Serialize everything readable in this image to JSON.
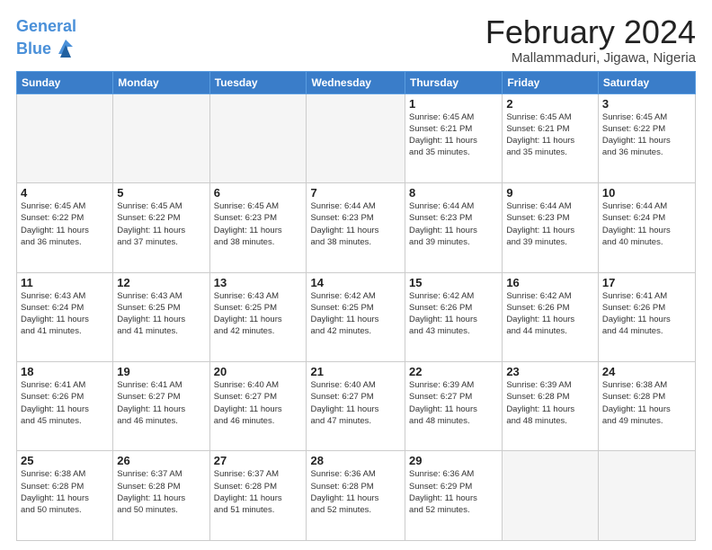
{
  "header": {
    "logo_line1": "General",
    "logo_line2": "Blue",
    "title": "February 2024",
    "subtitle": "Mallammaduri, Jigawa, Nigeria"
  },
  "days_of_week": [
    "Sunday",
    "Monday",
    "Tuesday",
    "Wednesday",
    "Thursday",
    "Friday",
    "Saturday"
  ],
  "weeks": [
    [
      {
        "day": "",
        "info": ""
      },
      {
        "day": "",
        "info": ""
      },
      {
        "day": "",
        "info": ""
      },
      {
        "day": "",
        "info": ""
      },
      {
        "day": "1",
        "info": "Sunrise: 6:45 AM\nSunset: 6:21 PM\nDaylight: 11 hours\nand 35 minutes."
      },
      {
        "day": "2",
        "info": "Sunrise: 6:45 AM\nSunset: 6:21 PM\nDaylight: 11 hours\nand 35 minutes."
      },
      {
        "day": "3",
        "info": "Sunrise: 6:45 AM\nSunset: 6:22 PM\nDaylight: 11 hours\nand 36 minutes."
      }
    ],
    [
      {
        "day": "4",
        "info": "Sunrise: 6:45 AM\nSunset: 6:22 PM\nDaylight: 11 hours\nand 36 minutes."
      },
      {
        "day": "5",
        "info": "Sunrise: 6:45 AM\nSunset: 6:22 PM\nDaylight: 11 hours\nand 37 minutes."
      },
      {
        "day": "6",
        "info": "Sunrise: 6:45 AM\nSunset: 6:23 PM\nDaylight: 11 hours\nand 38 minutes."
      },
      {
        "day": "7",
        "info": "Sunrise: 6:44 AM\nSunset: 6:23 PM\nDaylight: 11 hours\nand 38 minutes."
      },
      {
        "day": "8",
        "info": "Sunrise: 6:44 AM\nSunset: 6:23 PM\nDaylight: 11 hours\nand 39 minutes."
      },
      {
        "day": "9",
        "info": "Sunrise: 6:44 AM\nSunset: 6:23 PM\nDaylight: 11 hours\nand 39 minutes."
      },
      {
        "day": "10",
        "info": "Sunrise: 6:44 AM\nSunset: 6:24 PM\nDaylight: 11 hours\nand 40 minutes."
      }
    ],
    [
      {
        "day": "11",
        "info": "Sunrise: 6:43 AM\nSunset: 6:24 PM\nDaylight: 11 hours\nand 41 minutes."
      },
      {
        "day": "12",
        "info": "Sunrise: 6:43 AM\nSunset: 6:25 PM\nDaylight: 11 hours\nand 41 minutes."
      },
      {
        "day": "13",
        "info": "Sunrise: 6:43 AM\nSunset: 6:25 PM\nDaylight: 11 hours\nand 42 minutes."
      },
      {
        "day": "14",
        "info": "Sunrise: 6:42 AM\nSunset: 6:25 PM\nDaylight: 11 hours\nand 42 minutes."
      },
      {
        "day": "15",
        "info": "Sunrise: 6:42 AM\nSunset: 6:26 PM\nDaylight: 11 hours\nand 43 minutes."
      },
      {
        "day": "16",
        "info": "Sunrise: 6:42 AM\nSunset: 6:26 PM\nDaylight: 11 hours\nand 44 minutes."
      },
      {
        "day": "17",
        "info": "Sunrise: 6:41 AM\nSunset: 6:26 PM\nDaylight: 11 hours\nand 44 minutes."
      }
    ],
    [
      {
        "day": "18",
        "info": "Sunrise: 6:41 AM\nSunset: 6:26 PM\nDaylight: 11 hours\nand 45 minutes."
      },
      {
        "day": "19",
        "info": "Sunrise: 6:41 AM\nSunset: 6:27 PM\nDaylight: 11 hours\nand 46 minutes."
      },
      {
        "day": "20",
        "info": "Sunrise: 6:40 AM\nSunset: 6:27 PM\nDaylight: 11 hours\nand 46 minutes."
      },
      {
        "day": "21",
        "info": "Sunrise: 6:40 AM\nSunset: 6:27 PM\nDaylight: 11 hours\nand 47 minutes."
      },
      {
        "day": "22",
        "info": "Sunrise: 6:39 AM\nSunset: 6:27 PM\nDaylight: 11 hours\nand 48 minutes."
      },
      {
        "day": "23",
        "info": "Sunrise: 6:39 AM\nSunset: 6:28 PM\nDaylight: 11 hours\nand 48 minutes."
      },
      {
        "day": "24",
        "info": "Sunrise: 6:38 AM\nSunset: 6:28 PM\nDaylight: 11 hours\nand 49 minutes."
      }
    ],
    [
      {
        "day": "25",
        "info": "Sunrise: 6:38 AM\nSunset: 6:28 PM\nDaylight: 11 hours\nand 50 minutes."
      },
      {
        "day": "26",
        "info": "Sunrise: 6:37 AM\nSunset: 6:28 PM\nDaylight: 11 hours\nand 50 minutes."
      },
      {
        "day": "27",
        "info": "Sunrise: 6:37 AM\nSunset: 6:28 PM\nDaylight: 11 hours\nand 51 minutes."
      },
      {
        "day": "28",
        "info": "Sunrise: 6:36 AM\nSunset: 6:28 PM\nDaylight: 11 hours\nand 52 minutes."
      },
      {
        "day": "29",
        "info": "Sunrise: 6:36 AM\nSunset: 6:29 PM\nDaylight: 11 hours\nand 52 minutes."
      },
      {
        "day": "",
        "info": ""
      },
      {
        "day": "",
        "info": ""
      }
    ]
  ]
}
